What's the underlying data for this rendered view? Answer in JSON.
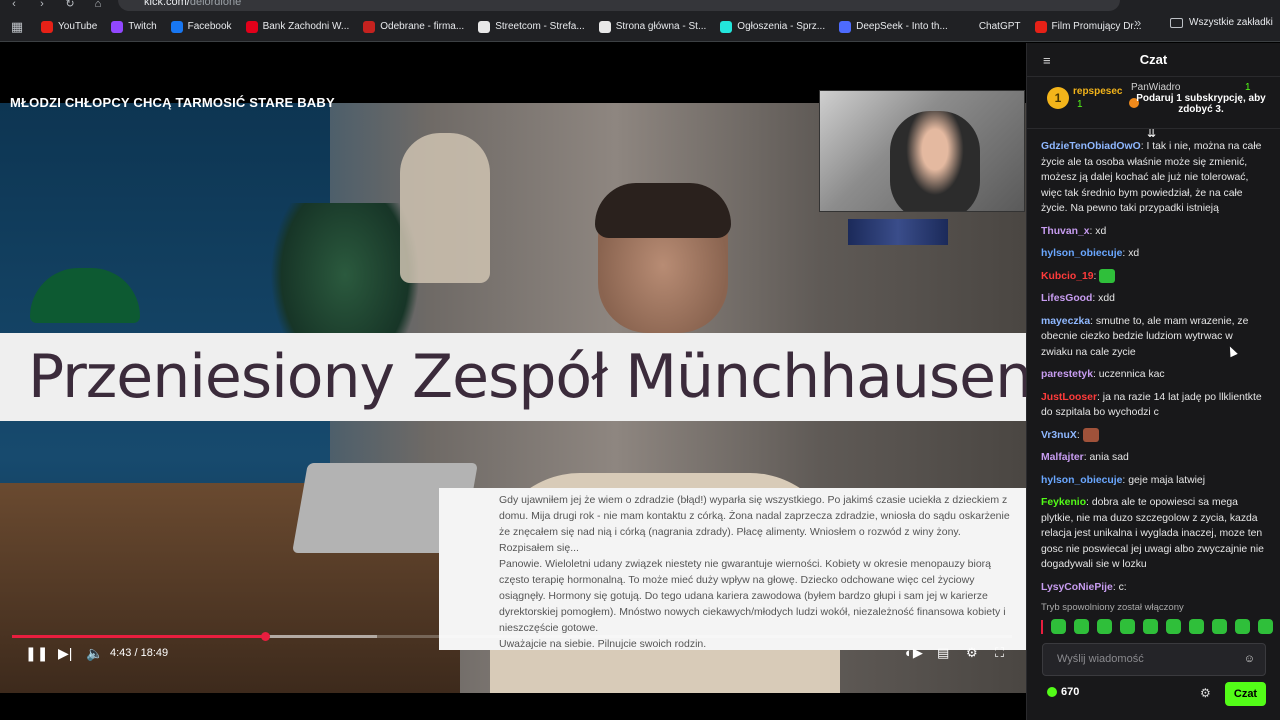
{
  "browser": {
    "url_host": "kick.com/",
    "url_path": "delordione",
    "bookmarks": [
      {
        "label": "YouTube",
        "color": "#e62117"
      },
      {
        "label": "Twitch",
        "color": "#9147ff"
      },
      {
        "label": "Facebook",
        "color": "#1877f2"
      },
      {
        "label": "Bank Zachodni W...",
        "color": "#e2001a"
      },
      {
        "label": "Odebrane - firma...",
        "color": "#c5221f"
      },
      {
        "label": "Streetcom - Strefa...",
        "color": "#e8e8e8"
      },
      {
        "label": "Strona główna - St...",
        "color": "#e8e8e8"
      },
      {
        "label": "Ogłoszenia - Sprz...",
        "color": "#23e5db"
      },
      {
        "label": "DeepSeek - Into th...",
        "color": "#4d6bfe"
      },
      {
        "label": "ChatGPT",
        "color": "#202124"
      },
      {
        "label": "Film Promujący Dr...",
        "color": "#e62117"
      }
    ],
    "all_bookmarks": "Wszystkie zakładki"
  },
  "video": {
    "title": "MŁODZI CHŁOPCY CHCĄ TARMOSIĆ STARE BABY",
    "banner": "Przeniesiony Zespół Münchhausena",
    "note": "Gdy ujawniłem jej że wiem o zdradzie (błąd!) wyparła się wszystkiego. Po jakimś czasie uciekła z dzieckiem z domu. Mija drugi rok - nie mam kontaktu z córką. Żona nadal zaprzecza zdradzie, wniosła do sądu oskarżenie że znęcałem się nad nią i córką (nagrania zdrady). Płacę alimenty. Wniosłem o rozwód z winy żony.\nRozpisałem się...\nPanowie. Wieloletni udany związek niestety nie gwarantuje wierności. Kobiety w okresie menopauzy biorą często terapię hormonalną. To może mieć duży wpływ na głowę. Dziecko odchowane więc cel życiowy osiągnęły. Hormony się gotują. Do tego udana kariera zawodowa (byłem bardzo głupi i sam jej w karierze dyrektorskiej pomogłem). Mnóstwo nowych ciekawych/młodych ludzi wokół, niezależność finansowa kobiety i nieszczęście gotowe.\nUważajcie na siebie. Pilnujcie swoich rodzin.",
    "time": "4:43 / 18:49",
    "progress_played": 0.253,
    "progress_buffered": 0.365
  },
  "chat": {
    "title": "Czat",
    "pinned": {
      "top_user": "repspesec",
      "top_count": "1",
      "rank": "1",
      "gifter": "PanWiadro",
      "gifter_count": "1",
      "gift_text": "Podaruj 1 subskrypcję, aby zdobyć 3."
    },
    "messages": [
      {
        "user": "GdzieTenObiadOwO",
        "color": "#8fb8ff",
        "text": "I tak i nie, można na całe życie ale ta osoba właśnie może się zmienić, możesz ją dalej kochać ale już nie tolerować, więc tak średnio bym powiedział, że na całe życie. Na pewno taki przypadki istnieją"
      },
      {
        "user": "Thuvan_x",
        "color": "#c79cf0",
        "text": "xd"
      },
      {
        "user": "hylson_obiecuje",
        "color": "#6aa7ff",
        "text": "xd"
      },
      {
        "user": "Kubcio_19",
        "color": "#ff3b3b",
        "text": ""
      },
      {
        "user": "LifesGood",
        "color": "#c79cf0",
        "text": "xdd"
      },
      {
        "user": "mayeczka",
        "color": "#8fb8ff",
        "text": "smutne to, ale mam wrazenie, ze obecnie ciezko bedzie ludziom wytrwac w zwiaku na cale zycie"
      },
      {
        "user": "parestetyk",
        "color": "#c79cf0",
        "text": "uczennica kac"
      },
      {
        "user": "JustLooser",
        "color": "#ff3b3b",
        "text": "ja na razie 14 lat jadę po llklientkte do szpitala bo wychodzi c"
      },
      {
        "user": "Vr3nuX",
        "color": "#8fb8ff",
        "text": ""
      },
      {
        "user": "Malfajter",
        "color": "#c79cf0",
        "text": "ania sad"
      },
      {
        "user": "hylson_obiecuje",
        "color": "#6aa7ff",
        "text": "geje maja latwiej"
      },
      {
        "user": "Feykenio",
        "color": "#53fc18",
        "text": "dobra ale te opowiesci sa mega plytkie, nie ma duzo szczegolow z zycia, kazda relacja jest unikalna i wyglada inaczej, moze ten gosc nie poswiecal jej uwagi albo zwyczajnie nie dogadywali sie w lozku"
      },
      {
        "user": "LysyCoNiePije",
        "color": "#c79cf0",
        "text": "c:"
      }
    ],
    "slow_mode": "Tryb spowolniony został włączony",
    "placeholder": "Wyślij wiadomość",
    "points": "670",
    "send_label": "Czat",
    "accent": "#53fc18"
  }
}
